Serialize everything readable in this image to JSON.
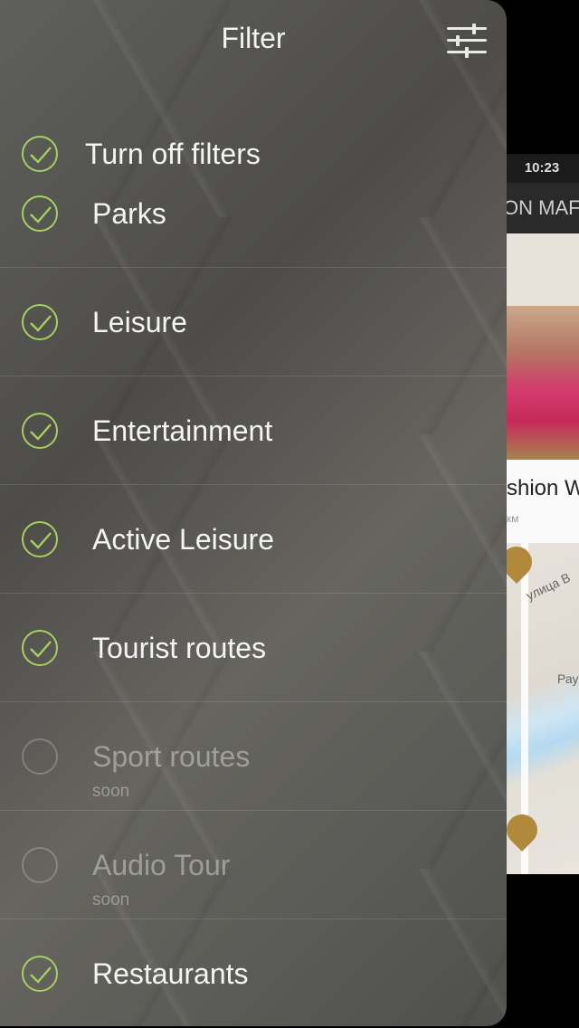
{
  "background_app": {
    "time": "10:23",
    "header_fragment": "ON MAF",
    "card_title_fragment": "shion W",
    "card_meta_fragment": "км",
    "street_fragment": "улица В",
    "street_fragment2": "Рау"
  },
  "filter": {
    "title": "Filter",
    "turn_off": {
      "label": "Turn off filters",
      "checked": true
    },
    "items": [
      {
        "label": "Parks",
        "checked": true
      },
      {
        "label": "Leisure",
        "checked": true
      },
      {
        "label": "Entertainment",
        "checked": true
      },
      {
        "label": "Active Leisure",
        "checked": true
      },
      {
        "label": "Tourist routes",
        "checked": true
      },
      {
        "label": "Sport routes",
        "checked": false,
        "note": "soon"
      },
      {
        "label": "Audio Tour",
        "checked": false,
        "note": "soon"
      },
      {
        "label": "Restaurants",
        "checked": true
      }
    ]
  },
  "colors": {
    "accent": "#a6d05e",
    "panel": "#55544f"
  },
  "icons": {
    "settings": "sliders-icon",
    "check": "checkmark-icon"
  }
}
